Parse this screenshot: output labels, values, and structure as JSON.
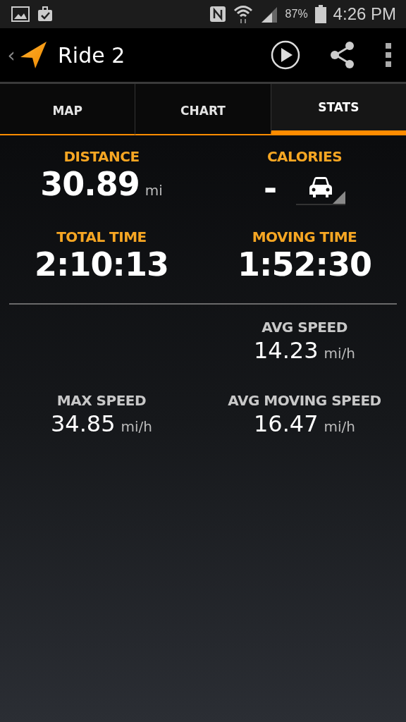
{
  "status_bar": {
    "battery": "87%",
    "time": "4:26 PM"
  },
  "app_bar": {
    "back": "‹",
    "title": "Ride 2"
  },
  "tabs": [
    {
      "label": "MAP",
      "selected": false
    },
    {
      "label": "CHART",
      "selected": false
    },
    {
      "label": "STATS",
      "selected": true
    }
  ],
  "main_stats": [
    {
      "label": "DISTANCE",
      "value": "30.89",
      "unit": "mi"
    },
    {
      "label": "CALORIES",
      "value": "-",
      "kind": "activity"
    },
    {
      "label": "TOTAL TIME",
      "value": "2:10:13"
    },
    {
      "label": "MOVING TIME",
      "value": "1:52:30"
    }
  ],
  "speed_rows": [
    {
      "right": {
        "label": "AVG SPEED",
        "value": "14.23",
        "unit": "mi/h"
      }
    },
    {
      "left": {
        "label": "MAX SPEED",
        "value": "34.85",
        "unit": "mi/h"
      },
      "right": {
        "label": "AVG MOVING SPEED",
        "value": "16.47",
        "unit": "mi/h"
      }
    }
  ]
}
